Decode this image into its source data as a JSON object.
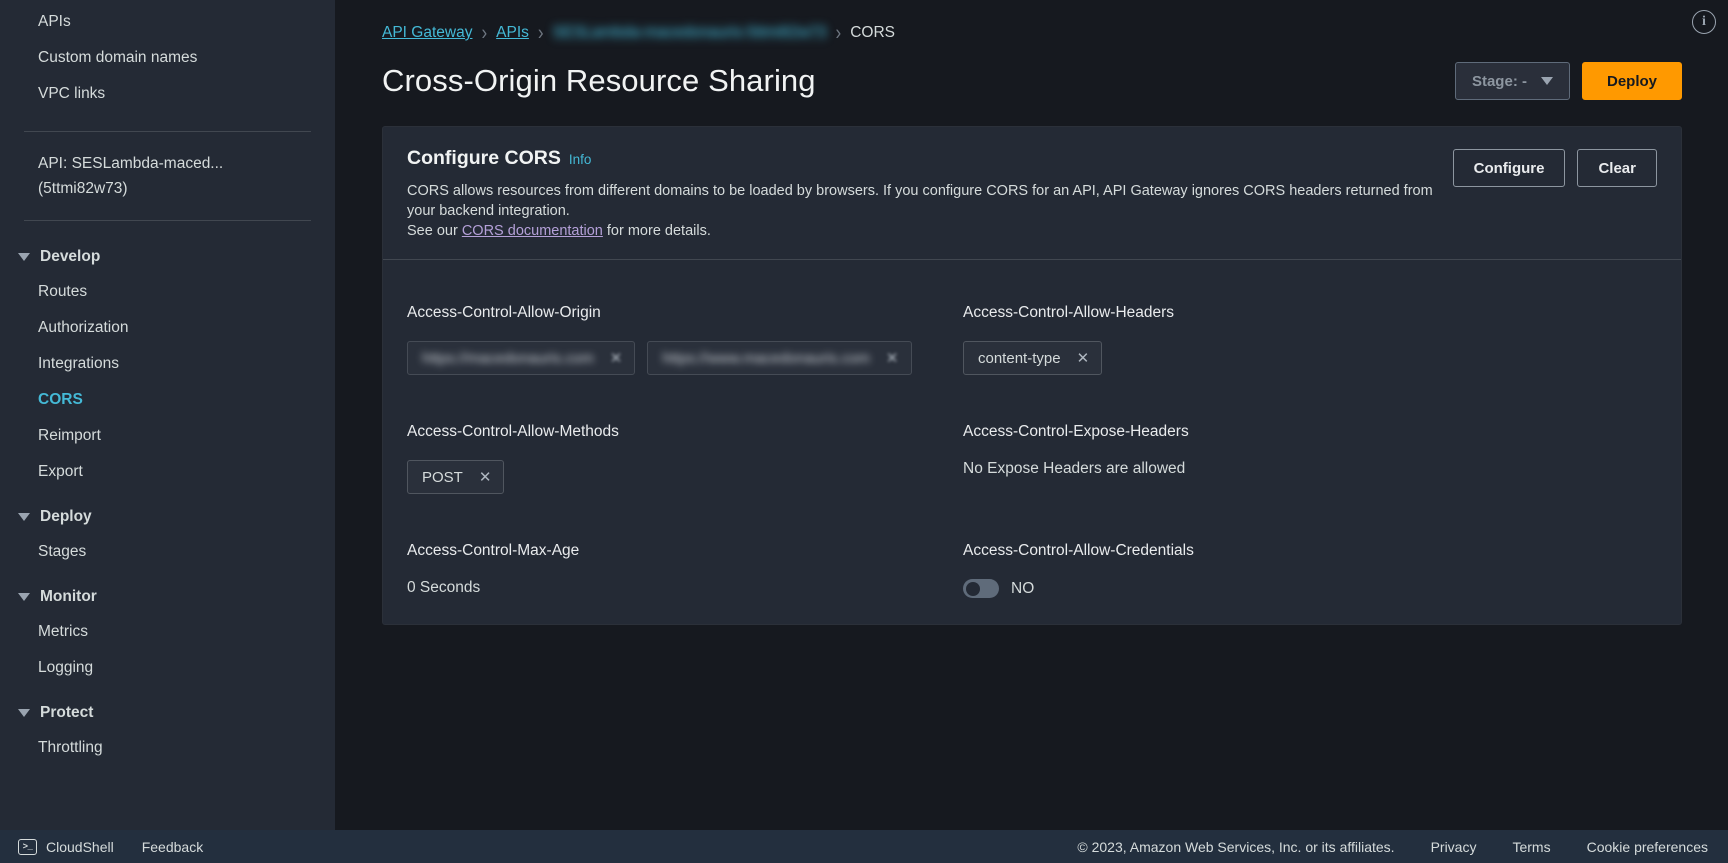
{
  "sidebar": {
    "top_items": [
      {
        "label": "APIs"
      },
      {
        "label": "Custom domain names"
      },
      {
        "label": "VPC links"
      }
    ],
    "api_ref": {
      "line1": "API: SESLambda-maced...",
      "line2": "(5ttmi82w73)"
    },
    "groups": [
      {
        "title": "Develop",
        "items": [
          {
            "label": "Routes",
            "selected": false
          },
          {
            "label": "Authorization",
            "selected": false
          },
          {
            "label": "Integrations",
            "selected": false
          },
          {
            "label": "CORS",
            "selected": true
          },
          {
            "label": "Reimport",
            "selected": false
          },
          {
            "label": "Export",
            "selected": false
          }
        ]
      },
      {
        "title": "Deploy",
        "items": [
          {
            "label": "Stages",
            "selected": false
          }
        ]
      },
      {
        "title": "Monitor",
        "items": [
          {
            "label": "Metrics",
            "selected": false
          },
          {
            "label": "Logging",
            "selected": false
          }
        ]
      },
      {
        "title": "Protect",
        "items": [
          {
            "label": "Throttling",
            "selected": false
          }
        ]
      }
    ]
  },
  "breadcrumb": [
    {
      "label": "API Gateway",
      "type": "link"
    },
    {
      "label": "APIs",
      "type": "link"
    },
    {
      "label": "SESLambda-macedonauris-5ttmi82w73",
      "type": "blurred"
    },
    {
      "label": "CORS",
      "type": "current"
    }
  ],
  "header": {
    "title": "Cross-Origin Resource Sharing",
    "stage_button": "Stage: -",
    "deploy_button": "Deploy"
  },
  "card": {
    "title": "Configure CORS",
    "info_label": "Info",
    "description_part1": "CORS allows resources from different domains to be loaded by browsers. If you configure CORS for an API, API Gateway ignores CORS headers returned from your backend integration.",
    "description_part2_pre": "See our ",
    "description_link": "CORS documentation",
    "description_part2_post": " for more details.",
    "configure_button": "Configure",
    "clear_button": "Clear"
  },
  "cors": {
    "allow_origin": {
      "label": "Access-Control-Allow-Origin",
      "chips": [
        {
          "value": "https://macedonauris.com",
          "blurred": true
        },
        {
          "value": "https://www.macedonauris.com",
          "blurred": true
        }
      ]
    },
    "allow_headers": {
      "label": "Access-Control-Allow-Headers",
      "chips": [
        {
          "value": "content-type",
          "blurred": false
        }
      ]
    },
    "allow_methods": {
      "label": "Access-Control-Allow-Methods",
      "chips": [
        {
          "value": "POST",
          "blurred": false
        }
      ]
    },
    "expose_headers": {
      "label": "Access-Control-Expose-Headers",
      "value": "No Expose Headers are allowed"
    },
    "max_age": {
      "label": "Access-Control-Max-Age",
      "value": "0 Seconds"
    },
    "allow_credentials": {
      "label": "Access-Control-Allow-Credentials",
      "toggle_state": "off",
      "toggle_label": "NO"
    }
  },
  "footer": {
    "cloudshell": "CloudShell",
    "feedback": "Feedback",
    "copyright": "© 2023, Amazon Web Services, Inc. or its affiliates.",
    "links": [
      {
        "label": "Privacy"
      },
      {
        "label": "Terms"
      },
      {
        "label": "Cookie preferences"
      }
    ]
  },
  "icons": {
    "chip_close": "✕",
    "info_corner": "i",
    "shell_prompt": ">_"
  }
}
